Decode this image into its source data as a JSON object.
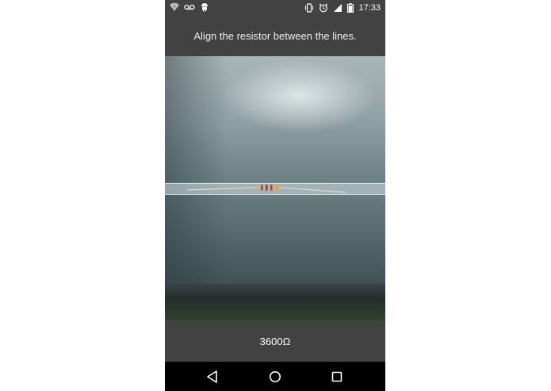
{
  "status_bar": {
    "time": "17:33",
    "left_icons": [
      "wifi-question-icon",
      "voicemail-icon",
      "android-icon"
    ],
    "right_icons": [
      "vibrate-icon",
      "alarm-icon",
      "signal-icon",
      "battery-icon"
    ]
  },
  "instruction": {
    "text": "Align the resistor between the lines."
  },
  "camera": {
    "description_colors": {
      "surface": "#7f9195",
      "guide": "#ffffff"
    },
    "resistor_bands": [
      "#8b5a2b",
      "#6a3e8a",
      "#c0392b",
      "#d4a64a"
    ]
  },
  "result": {
    "value": "3600Ω"
  },
  "nav_bar": {
    "buttons": [
      "back-icon",
      "home-icon",
      "recents-icon"
    ]
  },
  "colors": {
    "bar_background": "#424242",
    "nav_background": "#000000",
    "text": "#ffffff"
  }
}
